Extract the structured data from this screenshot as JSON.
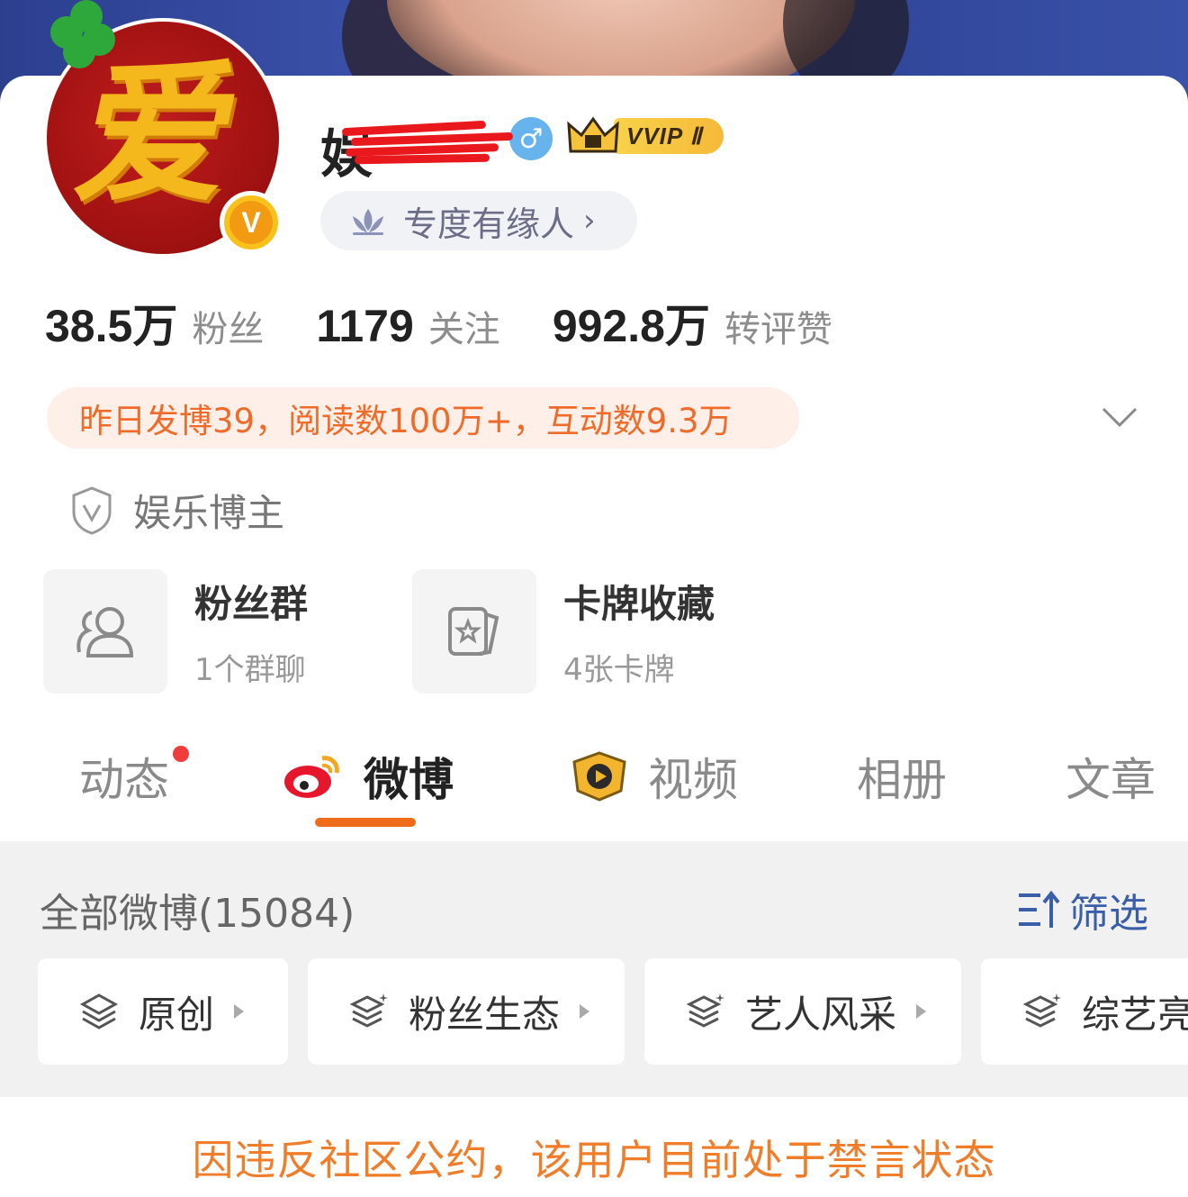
{
  "profile": {
    "name_visible": "娱",
    "gender_symbol": "♂",
    "vip_label": "VVIP Ⅱ",
    "relation_label": "专度有缘人",
    "relation_chevron": "›",
    "avatar_glyph": "爱",
    "verify_badge": "V"
  },
  "stats": [
    {
      "num": "38.5万",
      "label": "粉丝"
    },
    {
      "num": "1179",
      "label": "关注"
    },
    {
      "num": "992.8万",
      "label": "转评赞"
    }
  ],
  "summary": "昨日发博39，阅读数100万+，互动数9.3万",
  "certification": "娱乐博主",
  "features": [
    {
      "title": "粉丝群",
      "sub": "1个群聊"
    },
    {
      "title": "卡牌收藏",
      "sub": "4张卡牌"
    }
  ],
  "tabs": [
    "动态",
    "微博",
    "视频",
    "相册",
    "文章"
  ],
  "feed": {
    "count_label": "全部微博(15084)",
    "filter_label": "筛选",
    "chips": [
      "原创",
      "粉丝生态",
      "艺人风采",
      "综艺亮"
    ]
  },
  "notice": "因违反社区公约，该用户目前处于禁言状态",
  "colors": {
    "accent_orange": "#ef6c1a",
    "notice_orange": "#ef7d2a",
    "filter_blue": "#3a5fa8",
    "vip_gold": "#f6b93a",
    "gender_blue": "#67b3ee"
  }
}
